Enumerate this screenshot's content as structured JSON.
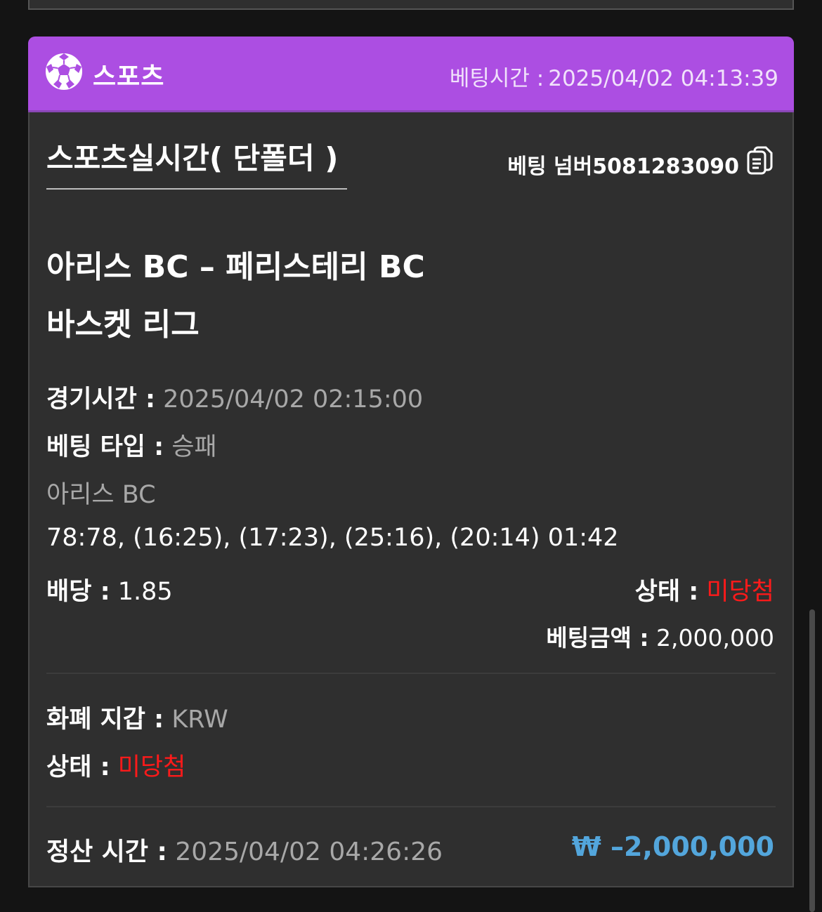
{
  "header": {
    "category": "스포츠",
    "bet_time_label": "베팅시간 :",
    "bet_time": "2025/04/02 04:13:39"
  },
  "bet": {
    "section_title": "스포츠실시간( 단폴더 )",
    "bet_number_label": "베팅 넘버",
    "bet_number": "5081283090",
    "match": "아리스 BC – 페리스테리 BC",
    "league": "바스켓 리그",
    "game_time_label": "경기시간 :",
    "game_time": "2025/04/02 02:15:00",
    "bet_type_label": "베팅 타입 :",
    "bet_type": "승패",
    "pick": "아리스 BC",
    "score": "78:78, (16:25), (17:23), (25:16), (20:14) 01:42",
    "odds_label": "배당 :",
    "odds": "1.85",
    "status_label": "상태 :",
    "status": "미당첨",
    "bet_amount_label": "베팅금액 :",
    "bet_amount": "2,000,000"
  },
  "wallet": {
    "currency_label": "화폐 지갑 :",
    "currency": "KRW",
    "status_label": "상태 :",
    "status": "미당첨"
  },
  "settlement": {
    "time_label": "정산 시간 :",
    "time": "2025/04/02 04:26:26",
    "amount": "₩ –2,000,000"
  },
  "colors": {
    "header_bg": "#ac4ee2",
    "card_bg": "#2f2f2f",
    "page_bg": "#141414",
    "lose_red": "#ff1a1a",
    "amount_blue": "#53a6dc"
  },
  "icons": {
    "category": "soccer-ball-icon",
    "copy": "copy-document-icon"
  }
}
